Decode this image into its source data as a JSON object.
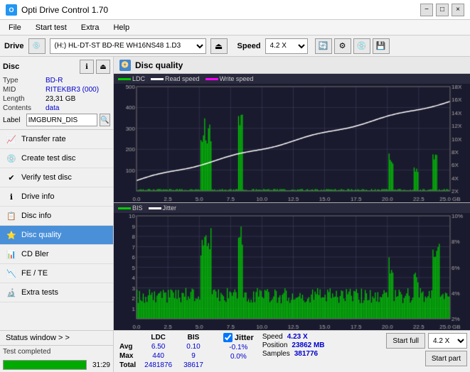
{
  "titlebar": {
    "title": "Opti Drive Control 1.70",
    "icon": "O",
    "minimize": "−",
    "maximize": "□",
    "close": "×"
  },
  "menubar": {
    "items": [
      "File",
      "Start test",
      "Extra",
      "Help"
    ]
  },
  "drivebar": {
    "label": "Drive",
    "drive_value": "(H:)  HL-DT-ST BD-RE  WH16NS48 1.D3",
    "speed_label": "Speed",
    "speed_value": "4.2 X"
  },
  "disc": {
    "title": "Disc",
    "type_label": "Type",
    "type_value": "BD-R",
    "mid_label": "MID",
    "mid_value": "RITEKBR3 (000)",
    "length_label": "Length",
    "length_value": "23,31 GB",
    "contents_label": "Contents",
    "contents_value": "data",
    "label_label": "Label",
    "label_value": "IMGBURN_DIS"
  },
  "nav_items": [
    {
      "id": "transfer-rate",
      "label": "Transfer rate",
      "icon": "📈"
    },
    {
      "id": "create-test-disc",
      "label": "Create test disc",
      "icon": "💿"
    },
    {
      "id": "verify-test-disc",
      "label": "Verify test disc",
      "icon": "✔"
    },
    {
      "id": "drive-info",
      "label": "Drive info",
      "icon": "ℹ"
    },
    {
      "id": "disc-info",
      "label": "Disc info",
      "icon": "📋"
    },
    {
      "id": "disc-quality",
      "label": "Disc quality",
      "icon": "⭐",
      "active": true
    },
    {
      "id": "cd-bler",
      "label": "CD Bler",
      "icon": "📊"
    },
    {
      "id": "fe-te",
      "label": "FE / TE",
      "icon": "📉"
    },
    {
      "id": "extra-tests",
      "label": "Extra tests",
      "icon": "🔬"
    }
  ],
  "status": {
    "window_label": "Status window > >",
    "progress": 100,
    "status_text": "Test completed",
    "time": "31:29"
  },
  "quality_panel": {
    "title": "Disc quality",
    "legend": {
      "ldc_label": "LDC",
      "ldc_color": "#00cc00",
      "read_speed_label": "Read speed",
      "read_speed_color": "#ffffff",
      "write_speed_label": "Write speed",
      "write_speed_color": "#ff00ff",
      "bis_label": "BIS",
      "bis_color": "#00cc00",
      "jitter_label": "Jitter",
      "jitter_color": "#ffffff"
    },
    "top_chart": {
      "y_max": 500,
      "y_left_labels": [
        500,
        400,
        300,
        200,
        100
      ],
      "y_right_labels": [
        "18X",
        "16X",
        "14X",
        "12X",
        "10X",
        "8X",
        "6X",
        "4X",
        "2X"
      ],
      "x_labels": [
        "0.0",
        "2.5",
        "5.0",
        "7.5",
        "10.0",
        "12.5",
        "15.0",
        "17.5",
        "20.0",
        "22.5",
        "25.0 GB"
      ]
    },
    "bottom_chart": {
      "y_left_labels": [
        10,
        9,
        8,
        7,
        6,
        5,
        4,
        3,
        2,
        1
      ],
      "y_right_labels": [
        "10%",
        "8%",
        "6%",
        "4%",
        "2%"
      ],
      "x_labels": [
        "0.0",
        "2.5",
        "5.0",
        "7.5",
        "10.0",
        "12.5",
        "15.0",
        "17.5",
        "20.0",
        "22.5",
        "25.0 GB"
      ]
    },
    "stats": {
      "avg_label": "Avg",
      "max_label": "Max",
      "total_label": "Total",
      "ldc_avg": "6.50",
      "ldc_max": "440",
      "ldc_total": "2481876",
      "bis_avg": "0.10",
      "bis_max": "9",
      "bis_total": "38617",
      "jitter_avg": "-0.1%",
      "jitter_max": "0.0%",
      "jitter_total": "",
      "speed_label": "Speed",
      "speed_value": "4.23 X",
      "position_label": "Position",
      "position_value": "23862 MB",
      "samples_label": "Samples",
      "samples_value": "381776",
      "jitter_check": true,
      "jitter_check_label": "Jitter",
      "speed_dropdown": "4.2 X",
      "start_full_btn": "Start full",
      "start_part_btn": "Start part"
    }
  }
}
